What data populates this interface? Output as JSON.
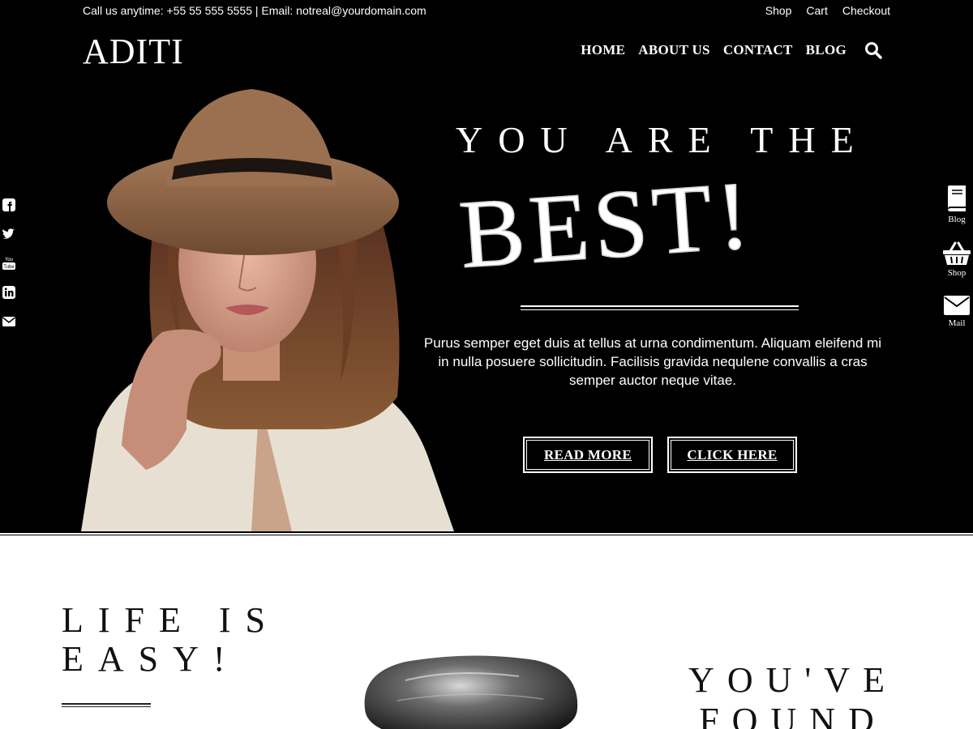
{
  "topbar": {
    "contact": "Call us anytime: +55 55 555 5555 | Email: notreal@yourdomain.com",
    "links": [
      "Shop",
      "Cart",
      "Checkout"
    ]
  },
  "logo": "ADITI",
  "nav": {
    "items": [
      "HOME",
      "ABOUT US",
      "CONTACT",
      "BLOG"
    ],
    "search_icon": "search-icon"
  },
  "hero": {
    "title": "YOU ARE THE",
    "highlight": "BEST!",
    "text": "Purus semper eget duis at tellus at urna condimentum. Aliquam eleifend mi in nulla posuere sollicitudin. Facilisis gravida nequlene convallis a cras semper auctor neque vitae.",
    "read_more": "READ MORE",
    "click_here": "CLICK HERE"
  },
  "social": [
    "facebook-icon",
    "twitter-icon",
    "youtube-icon",
    "linkedin-icon",
    "mail-icon"
  ],
  "side_links": [
    {
      "label": "Blog",
      "icon": "book-icon"
    },
    {
      "label": "Shop",
      "icon": "basket-icon"
    },
    {
      "label": "Mail",
      "icon": "envelope-icon"
    }
  ],
  "section2": {
    "left_title": "LIFE IS EASY!",
    "right_title": "YOU'VE FOUND"
  },
  "colors": {
    "hero_bg": "#000000",
    "text_light": "#ffffff",
    "text_dark": "#111111"
  }
}
